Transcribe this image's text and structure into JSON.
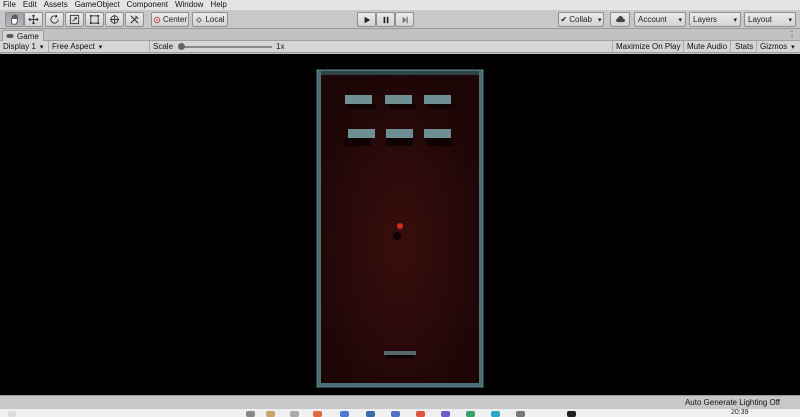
{
  "menu": [
    "File",
    "Edit",
    "Assets",
    "GameObject",
    "Component",
    "Window",
    "Help"
  ],
  "toolbar": {
    "tools": [
      "hand-tool-icon",
      "move-tool-icon",
      "rotate-tool-icon",
      "scale-tool-icon",
      "rect-tool-icon",
      "transform-tool-icon",
      "custom-tool-icon"
    ],
    "pivot_label": "Center",
    "space_label": "Local",
    "collab_label": "Collab",
    "account_label": "Account",
    "layers_label": "Layers",
    "layout_label": "Layout"
  },
  "tab": {
    "label": "Game",
    "menu_icon": "⋮"
  },
  "gamebar": {
    "display": "Display 1",
    "aspect": "Free Aspect",
    "scale_label": "Scale",
    "scale_value": "1x",
    "maximize": "Maximize On Play",
    "mute": "Mute Audio",
    "stats": "Stats",
    "gizmos": "Gizmos"
  },
  "status": {
    "text": "Auto Generate Lighting Off"
  },
  "taskbar": {
    "clock": "20:39"
  },
  "colors": {
    "field": "#2a0b0b",
    "frame": "#3f5f64",
    "brick": "#6f9092",
    "ball": "#d5281d",
    "paddle": "#556a6c"
  }
}
